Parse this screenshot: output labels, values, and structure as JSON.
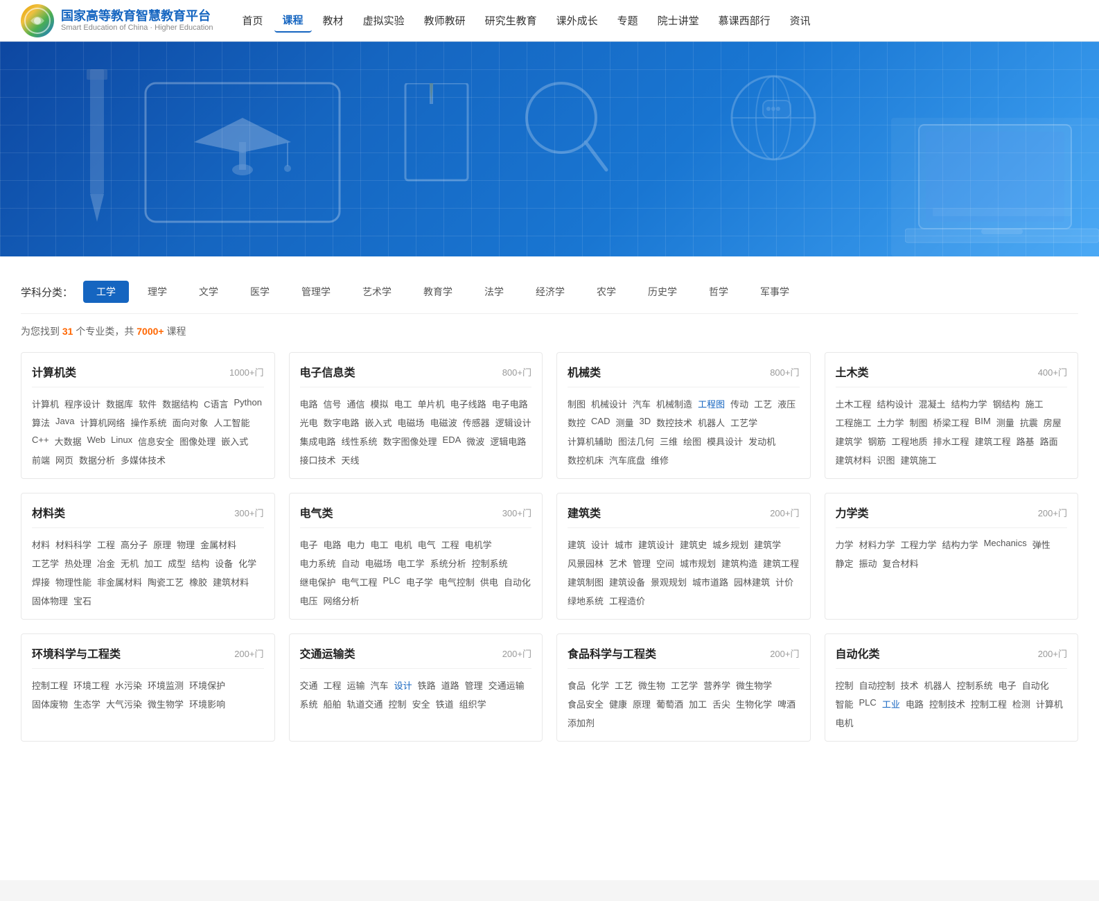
{
  "header": {
    "logo_title": "国家高等教育智慧教育平台",
    "logo_subtitle": "Smart Education of China · Higher Education",
    "nav": [
      {
        "label": "首页",
        "active": false
      },
      {
        "label": "课程",
        "active": true
      },
      {
        "label": "教材",
        "active": false
      },
      {
        "label": "虚拟实验",
        "active": false
      },
      {
        "label": "教师教研",
        "active": false
      },
      {
        "label": "研究生教育",
        "active": false
      },
      {
        "label": "课外成长",
        "active": false
      },
      {
        "label": "专题",
        "active": false
      },
      {
        "label": "院士讲堂",
        "active": false
      },
      {
        "label": "慕课西部行",
        "active": false
      },
      {
        "label": "资讯",
        "active": false
      }
    ]
  },
  "filter": {
    "label": "学科分类：",
    "tags": [
      {
        "label": "工学",
        "active": true
      },
      {
        "label": "理学",
        "active": false
      },
      {
        "label": "文学",
        "active": false
      },
      {
        "label": "医学",
        "active": false
      },
      {
        "label": "管理学",
        "active": false
      },
      {
        "label": "艺术学",
        "active": false
      },
      {
        "label": "教育学",
        "active": false
      },
      {
        "label": "法学",
        "active": false
      },
      {
        "label": "经济学",
        "active": false
      },
      {
        "label": "农学",
        "active": false
      },
      {
        "label": "历史学",
        "active": false
      },
      {
        "label": "哲学",
        "active": false
      },
      {
        "label": "军事学",
        "active": false
      }
    ]
  },
  "result_info": {
    "prefix": "为您找到 ",
    "count1": "31",
    "mid1": " 个专业类，共 ",
    "count2": "7000+",
    "suffix": " 课程"
  },
  "categories": [
    {
      "title": "计算机类",
      "count": "1000+门",
      "tags": [
        "计算机",
        "程序设计",
        "数据库",
        "软件",
        "数据结构",
        "C语言",
        "Python",
        "算法",
        "Java",
        "计算机网络",
        "操作系统",
        "面向对象",
        "人工智能",
        "C++",
        "大数据",
        "Web",
        "Linux",
        "信息安全",
        "图像处理",
        "嵌入式",
        "前端",
        "网页",
        "数据分析",
        "多媒体技术"
      ]
    },
    {
      "title": "电子信息类",
      "count": "800+门",
      "tags": [
        "电路",
        "信号",
        "通信",
        "模拟",
        "电工",
        "单片机",
        "电子线路",
        "电子电路",
        "光电",
        "数字电路",
        "嵌入式",
        "电磁场",
        "电磁波",
        "传感器",
        "逻辑设计",
        "集成电路",
        "线性系统",
        "数字图像处理",
        "EDA",
        "微波",
        "逻辑电路",
        "接口技术",
        "天线"
      ]
    },
    {
      "title": "机械类",
      "count": "800+门",
      "tags": [
        "制图",
        "机械设计",
        "汽车",
        "机械制造",
        "工程图",
        "传动",
        "工艺",
        "液压",
        "数控",
        "CAD",
        "测量",
        "3D",
        "数控技术",
        "机器人",
        "工艺学",
        "计算机辅助",
        "图法几何",
        "三维",
        "绘图",
        "模具设计",
        "发动机",
        "数控机床",
        "汽车底盘",
        "维修"
      ]
    },
    {
      "title": "土木类",
      "count": "400+门",
      "tags": [
        "土木工程",
        "结构设计",
        "混凝土",
        "结构力学",
        "钢结构",
        "施工",
        "工程施工",
        "土力学",
        "制图",
        "桥梁工程",
        "BIM",
        "测量",
        "抗震",
        "房屋",
        "建筑学",
        "钢筋",
        "工程地质",
        "排水工程",
        "建筑工程",
        "路基",
        "路面",
        "建筑材料",
        "识图",
        "建筑施工"
      ]
    },
    {
      "title": "材料类",
      "count": "300+门",
      "tags": [
        "材料",
        "材料科学",
        "工程",
        "高分子",
        "原理",
        "物理",
        "金属材料",
        "工艺学",
        "热处理",
        "冶金",
        "无机",
        "加工",
        "成型",
        "结构",
        "设备",
        "化学",
        "焊接",
        "物理性能",
        "非金属材料",
        "陶瓷工艺",
        "橡胶",
        "建筑材料",
        "固体物理",
        "宝石"
      ]
    },
    {
      "title": "电气类",
      "count": "300+门",
      "tags": [
        "电子",
        "电路",
        "电力",
        "电工",
        "电机",
        "电气",
        "工程",
        "电机学",
        "电力系统",
        "自动",
        "电磁场",
        "电工学",
        "系统分析",
        "控制系统",
        "继电保护",
        "电气工程",
        "PLC",
        "电子学",
        "电气控制",
        "供电",
        "自动化",
        "电压",
        "网络分析"
      ]
    },
    {
      "title": "建筑类",
      "count": "200+门",
      "tags": [
        "建筑",
        "设计",
        "城市",
        "建筑设计",
        "建筑史",
        "城乡规划",
        "建筑学",
        "风景园林",
        "艺术",
        "管理",
        "空间",
        "城市规划",
        "建筑构造",
        "建筑工程",
        "建筑制图",
        "建筑设备",
        "景观规划",
        "城市道路",
        "园林建筑",
        "计价",
        "绿地系统",
        "工程造价"
      ]
    },
    {
      "title": "力学类",
      "count": "200+门",
      "tags": [
        "力学",
        "材料力学",
        "工程力学",
        "结构力学",
        "Mechanics",
        "弹性",
        "静定",
        "振动",
        "复合材料"
      ]
    },
    {
      "title": "环境科学与工程类",
      "count": "200+门",
      "tags": [
        "控制工程",
        "环境工程",
        "水污染",
        "环境监测",
        "环境保护",
        "固体废物",
        "生态学",
        "大气污染",
        "微生物学",
        "环境影响"
      ]
    },
    {
      "title": "交通运输类",
      "count": "200+门",
      "tags": [
        "交通",
        "工程",
        "运输",
        "汽车",
        "设计",
        "铁路",
        "道路",
        "管理",
        "交通运输",
        "系统",
        "船舶",
        "轨道交通",
        "控制",
        "安全",
        "铁道",
        "组织学"
      ]
    },
    {
      "title": "食品科学与工程类",
      "count": "200+门",
      "tags": [
        "食品",
        "化学",
        "工艺",
        "微生物",
        "工艺学",
        "营养学",
        "微生物学",
        "食品安全",
        "健康",
        "原理",
        "葡萄酒",
        "加工",
        "舌尖",
        "生物化学",
        "啤酒",
        "添加剂"
      ]
    },
    {
      "title": "自动化类",
      "count": "200+门",
      "tags": [
        "控制",
        "自动控制",
        "技术",
        "机器人",
        "控制系统",
        "电子",
        "自动化",
        "智能",
        "PLC",
        "工业",
        "电路",
        "控制技术",
        "控制工程",
        "检测",
        "计算机",
        "电机"
      ]
    }
  ]
}
